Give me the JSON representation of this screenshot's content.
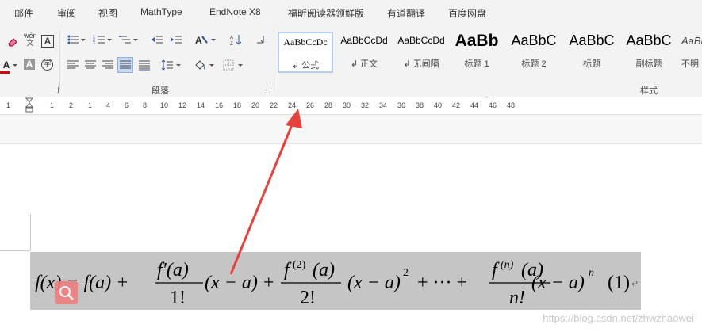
{
  "menu": {
    "tabs": [
      "邮件",
      "审阅",
      "视图",
      "MathType",
      "EndNote X8",
      "福昕阅读器领鲜版",
      "有道翻译",
      "百度网盘"
    ]
  },
  "ribbon": {
    "paragraph_group_label": "段落",
    "styles_group_label": "样式",
    "styles": [
      {
        "sample": "AaBbCcDc",
        "label": "↲ 公式"
      },
      {
        "sample": "AaBbCcDd",
        "label": "↲ 正文"
      },
      {
        "sample": "AaBbCcDd",
        "label": "↲ 无间隔"
      },
      {
        "sample": "AaBb",
        "label": "标题 1"
      },
      {
        "sample": "AaBbC",
        "label": "标题 2"
      },
      {
        "sample": "AaBbC",
        "label": "标题"
      },
      {
        "sample": "AaBbC",
        "label": "副标题"
      },
      {
        "sample": "AaBb",
        "label": "不明"
      }
    ]
  },
  "ruler": {
    "numbers": [
      "1",
      "1",
      "2",
      "1",
      "4",
      "6",
      "8",
      "10",
      "12",
      "14",
      "16",
      "18",
      "20",
      "22",
      "24",
      "26",
      "28",
      "30",
      "32",
      "34",
      "36",
      "38",
      "40",
      "42",
      "44",
      "46",
      "48"
    ]
  },
  "equation": {
    "lhs": "f(x) = f(a) +",
    "term1_num": "f′(a)",
    "term1_den": "1!",
    "term2_num_func": "f",
    "term2_num_sup": "(2)",
    "term2_num_arg": "(a)",
    "term2_den": "2!",
    "power2": "2",
    "ellipsis": "+ ··· +",
    "termn_num_func": "f",
    "termn_num_sup": "(n)",
    "termn_num_arg": "(a)",
    "termn_den": "n!",
    "factor": "(x − a)",
    "power_n": "n",
    "number": "(1)"
  },
  "watermark": "https://blog.csdn.net/zhwzhaowei",
  "colors": {
    "arrow": "#e8413b",
    "equation_bg": "#c5c5c5",
    "ribbon_bg": "#f3f3f3"
  }
}
